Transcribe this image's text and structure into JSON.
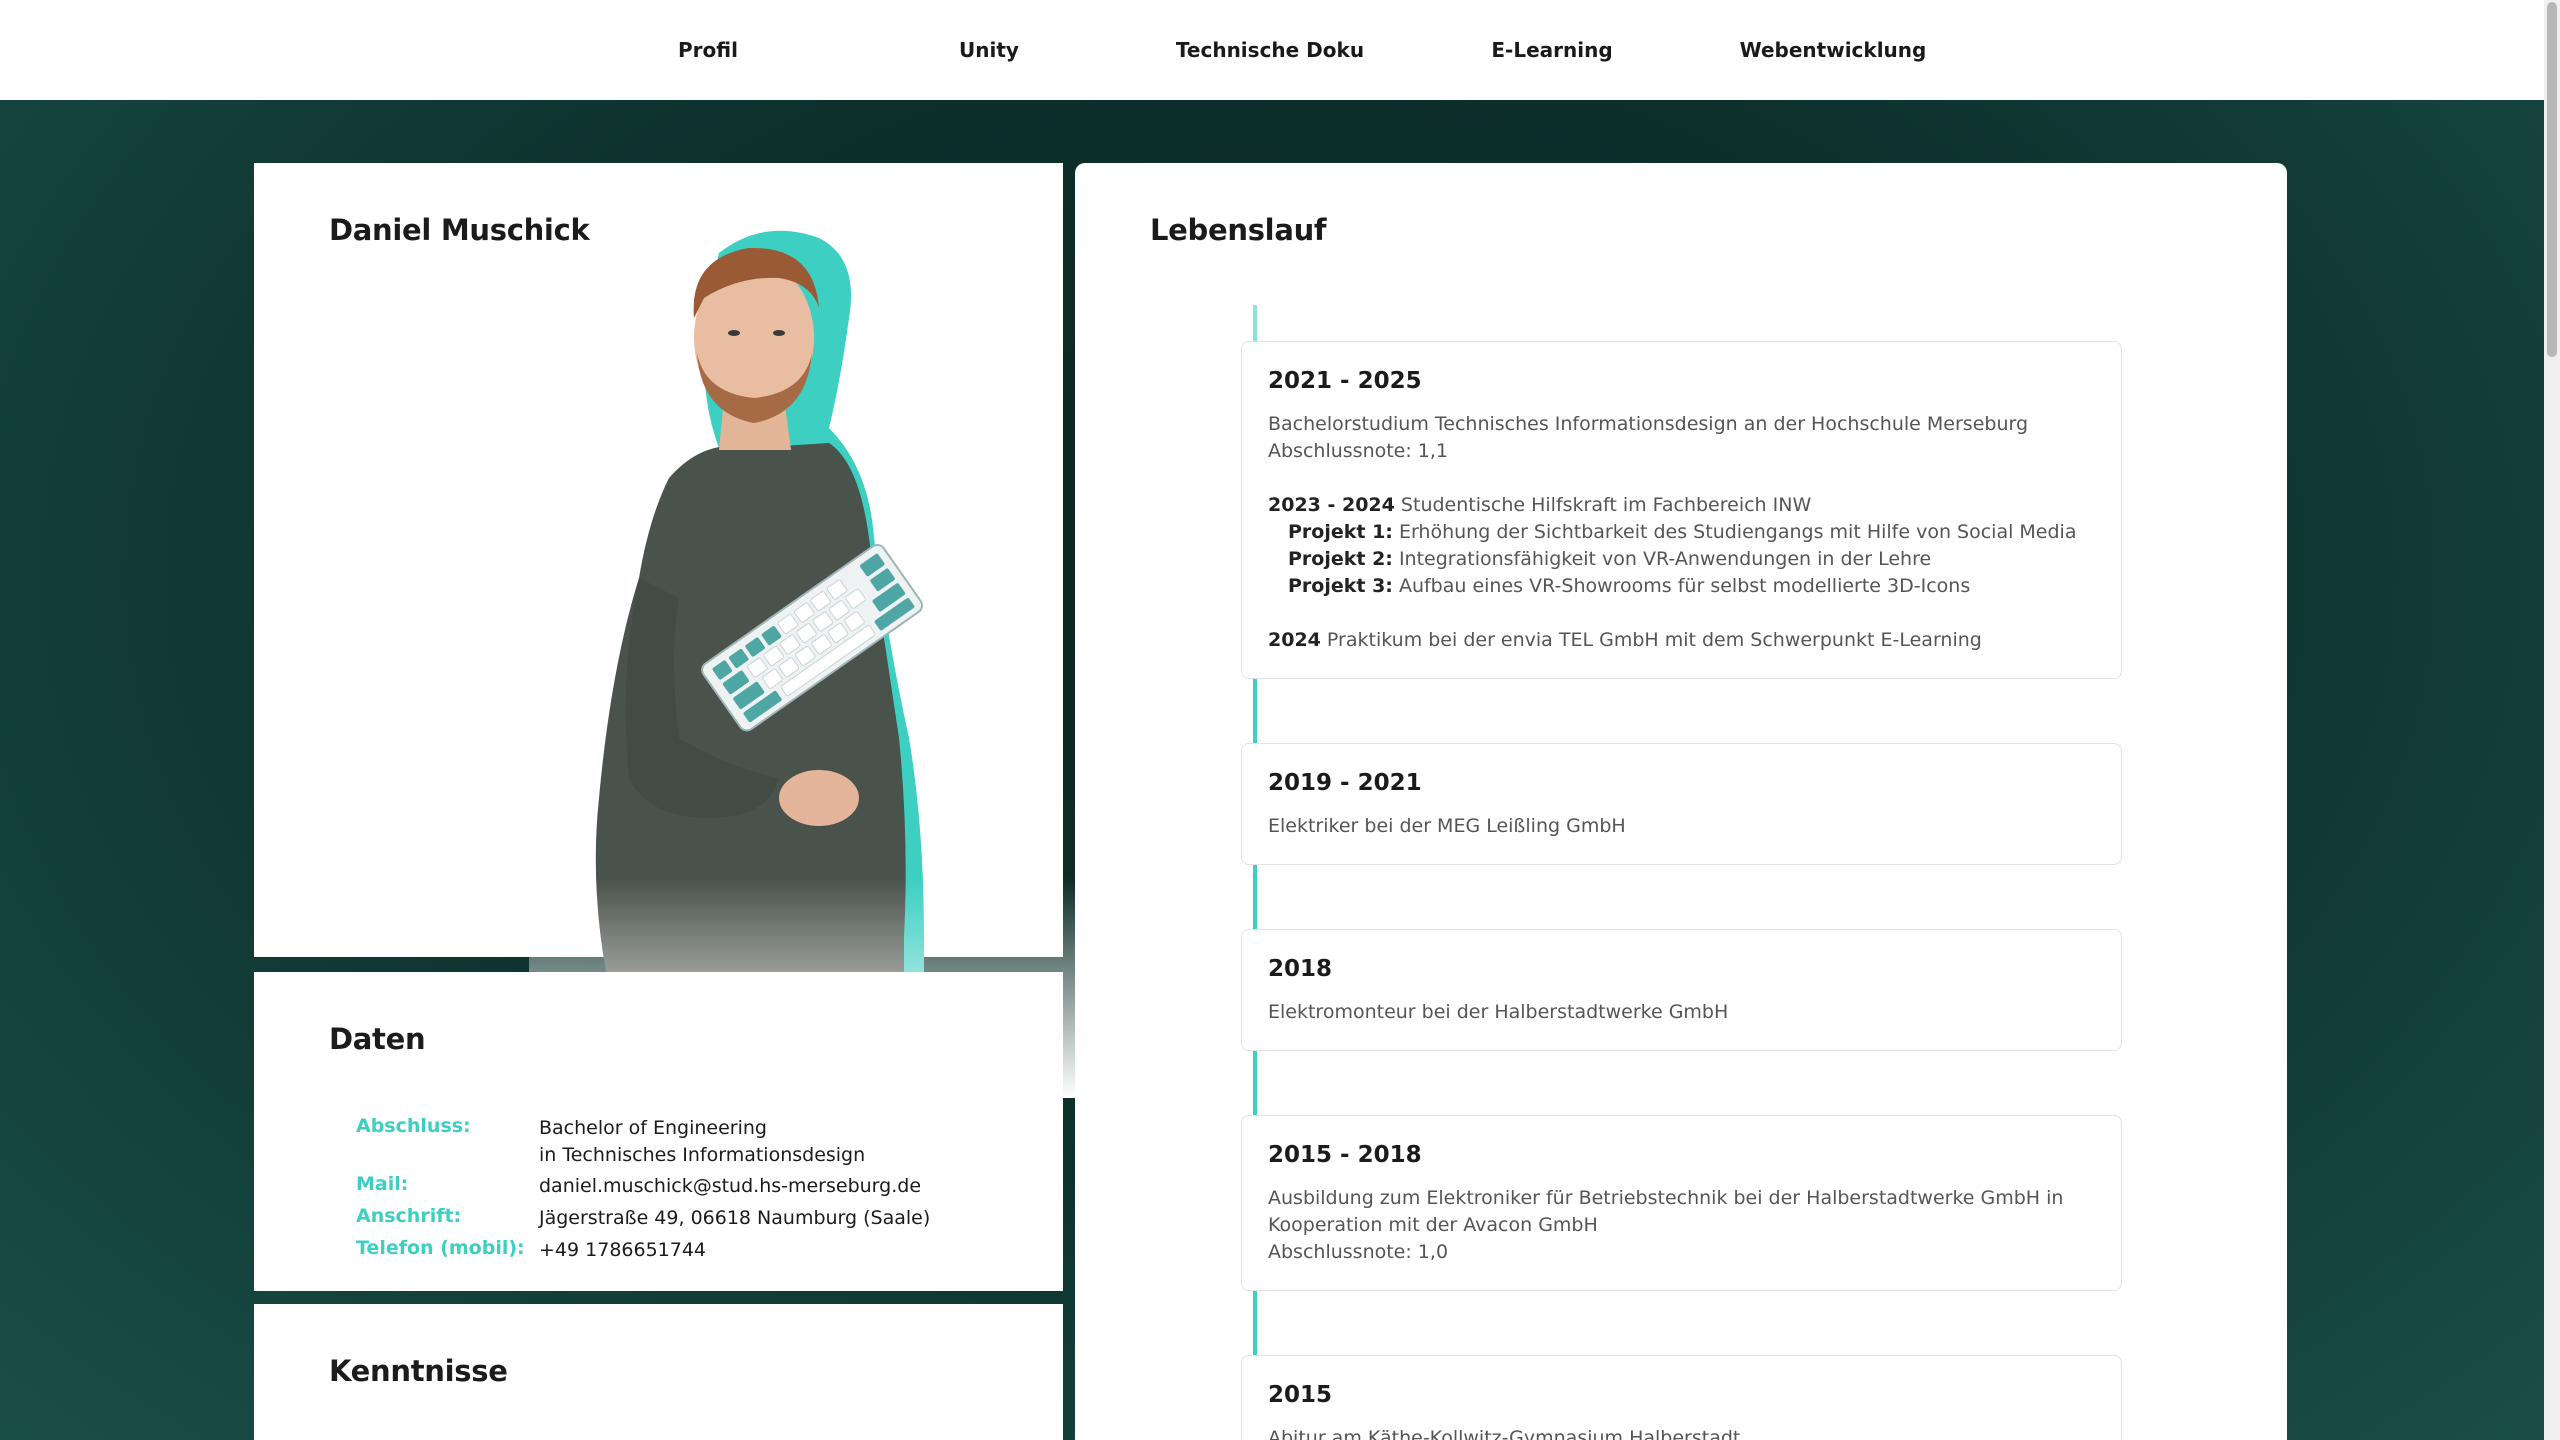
{
  "nav": {
    "items": [
      "Profil",
      "Unity",
      "Technische Doku",
      "E-Learning",
      "Webentwicklung"
    ]
  },
  "profile": {
    "name": "Daniel Muschick"
  },
  "daten": {
    "title": "Daten",
    "rows": [
      {
        "key": "Abschluss:",
        "value_line1": "Bachelor of Engineering",
        "value_line2": "in Technisches Informationsdesign"
      },
      {
        "key": "Mail:",
        "value_line1": "daniel.muschick@stud.hs-merseburg.de"
      },
      {
        "key": "Anschrift:",
        "value_line1": "Jägerstraße 49, 06618 Naumburg (Saale)"
      },
      {
        "key": "Telefon (mobil):",
        "value_line1": "+49 1786651744"
      }
    ]
  },
  "kenntnisse": {
    "title": "Kenntnisse"
  },
  "lebenslauf": {
    "title": "Lebenslauf",
    "entries": [
      {
        "year": "2021 - 2025",
        "line1": "Bachelorstudium Technisches Informationsdesign an der Hochschule Merseburg",
        "line2": "Abschlussnote: 1,1",
        "sub_year": "2023 - 2024",
        "sub_text": " Studentische Hilfskraft im Fachbereich INW",
        "projects": [
          {
            "label": "Projekt 1:",
            "text": " Erhöhung der Sichtbarkeit des Studiengangs mit Hilfe von Social Media"
          },
          {
            "label": "Projekt 2:",
            "text": " Integrationsfähigkeit von VR-Anwendungen in der Lehre"
          },
          {
            "label": "Projekt 3:",
            "text": " Aufbau eines VR-Showrooms für selbst modellierte 3D-Icons"
          }
        ],
        "extra_year": "2024",
        "extra_text": " Praktikum bei der envia TEL GmbH mit dem Schwerpunkt E-Learning"
      },
      {
        "year": "2019 - 2021",
        "line1": "Elektriker bei der MEG Leißling GmbH"
      },
      {
        "year": "2018",
        "line1": "Elektromonteur bei der Halberstadtwerke GmbH"
      },
      {
        "year": "2015 - 2018",
        "line1": "Ausbildung zum Elektroniker für Betriebstechnik bei der Halberstadtwerke GmbH in",
        "line2": "Kooperation mit der Avacon GmbH",
        "line3": "Abschlussnote: 1,0"
      },
      {
        "year": "2015",
        "line1": "Abitur am Käthe-Kollwitz-Gymnasium Halberstadt"
      }
    ]
  },
  "colors": {
    "accent": "#3ccfc2",
    "background_dark": "#0d302b",
    "hoodie": "#4a524c"
  }
}
